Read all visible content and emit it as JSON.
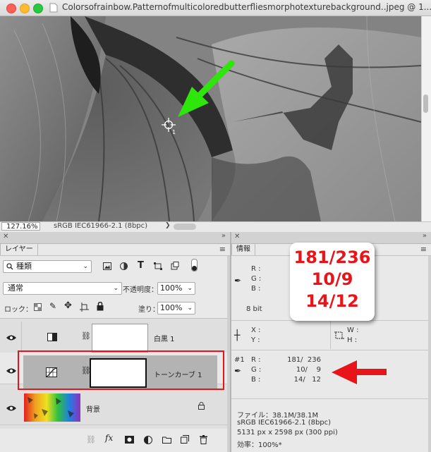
{
  "window": {
    "title": "Colorsofrainbow.Patternofmulticoloredbutterfliesmorphotexturebackground..jpeg @ 1..."
  },
  "statusbar": {
    "zoom": "127.16%",
    "profile": "sRGB IEC61966-2.1 (8bpc)",
    "arrow": "❯"
  },
  "layers_panel": {
    "tab_label": "レイヤー",
    "filter_kind": "種類",
    "blend_mode": "通常",
    "opacity_label": "不透明度：",
    "opacity_value": "100%",
    "lock_label": "ロック：",
    "fill_label": "塗り：",
    "fill_value": "100%",
    "layers": [
      {
        "name": "白黒 1",
        "selected": false
      },
      {
        "name": "トーンカーブ 1",
        "selected": true
      },
      {
        "name": "背景",
        "selected": false,
        "locked": true
      }
    ]
  },
  "info_panel": {
    "tab_label": "情報",
    "rgb_labels": [
      "R :",
      "G :",
      "B :"
    ],
    "bit_depth": "8 bit",
    "xy_labels": [
      "X :",
      "Y :"
    ],
    "wh_labels": [
      "W :",
      "H :"
    ],
    "sampler_id": "#1",
    "sampler_labels": [
      "R :",
      "G :",
      "B :"
    ],
    "sampler_values": [
      "181/  236",
      "10/    9",
      "14/   12"
    ],
    "file_line": "ファイル：38.1M/38.1M",
    "profile_line": "sRGB IEC61966-2.1 (8bpc)",
    "size_line": "5131 px x 2598 px (300 ppi)",
    "efficiency_line": "効率：100%*"
  },
  "callout": {
    "lines": [
      "181/236",
      "10/9",
      "14/12"
    ]
  },
  "colors": {
    "annotation_red": "#e8141a",
    "annotation_green": "#2ee60a",
    "selection_fill": "#b3b3b3"
  }
}
